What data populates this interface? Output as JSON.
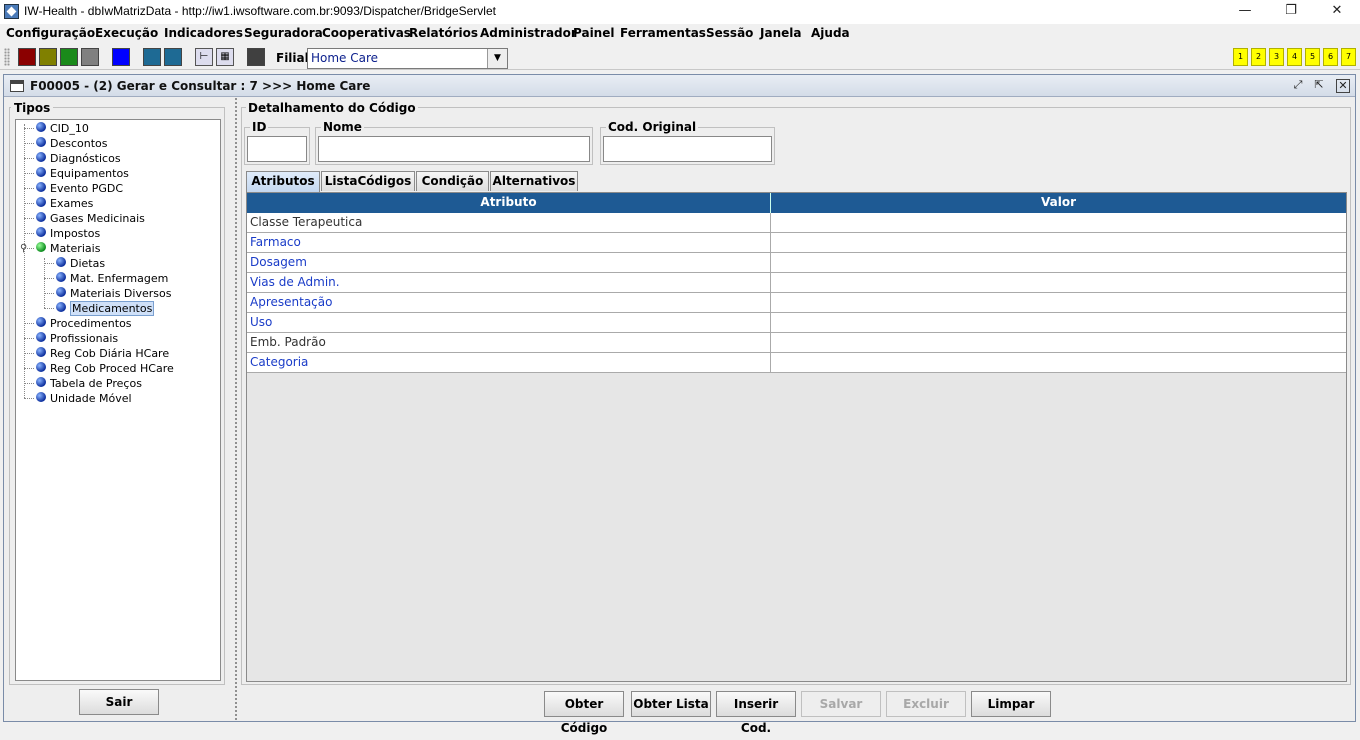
{
  "window": {
    "title": "IW-Health - dbIwMatrizData - http://iw1.iwsoftware.com.br:9093/Dispatcher/BridgeServlet",
    "minimize": "—",
    "restore": "❐",
    "close": "✕"
  },
  "menu": [
    "Configuração",
    "Execução",
    "Indicadores",
    "Seguradora",
    "Cooperativas",
    "Relatórios",
    "Administrador",
    "Painel",
    "Ferramentas",
    "Sessão",
    "Janela",
    "Ajuda"
  ],
  "toolbar": {
    "swatches": [
      "#8b0000",
      "#808000",
      "#1a8a1a",
      "#808080",
      "#0000ff",
      "#1e6a94",
      "#1e6a94",
      "#404040"
    ],
    "filial_label": "Filial:",
    "filial_value": "Home Care",
    "window_numbers": [
      "1",
      "2",
      "3",
      "4",
      "5",
      "6",
      "7"
    ]
  },
  "frame": {
    "title": "F00005 - (2) Gerar e Consultar : 7 >>> Home Care"
  },
  "tipos": {
    "label": "Tipos",
    "items": [
      "CID_10",
      "Descontos",
      "Diagnósticos",
      "Equipamentos",
      "Evento PGDC",
      "Exames",
      "Gases Medicinais",
      "Impostos",
      "Materiais",
      "Procedimentos",
      "Profissionais",
      "Reg Cob Diária HCare",
      "Reg Cob Proced HCare",
      "Tabela de Preços",
      "Unidade Móvel"
    ],
    "materiais_children": [
      "Dietas",
      "Mat. Enfermagem",
      "Materiais Diversos",
      "Medicamentos"
    ],
    "selected": "Medicamentos"
  },
  "sair": "Sair",
  "detail": {
    "label": "Detalhamento do Código",
    "id_label": "ID",
    "id_value": "",
    "nome_label": "Nome",
    "nome_value": "",
    "cod_original_label": "Cod. Original",
    "cod_original_value": ""
  },
  "tabs": [
    "Atributos",
    "ListaCódigos",
    "Condição",
    "Alternativos"
  ],
  "active_tab": "Atributos",
  "grid": {
    "headers": [
      "Atributo",
      "Valor"
    ],
    "rows": [
      {
        "atributo": "Classe Terapeutica",
        "valor": "",
        "style": "dark"
      },
      {
        "atributo": "Farmaco",
        "valor": "",
        "style": "blue"
      },
      {
        "atributo": "Dosagem",
        "valor": "",
        "style": "blue"
      },
      {
        "atributo": "Vias de Admin.",
        "valor": "",
        "style": "blue"
      },
      {
        "atributo": "Apresentação",
        "valor": "",
        "style": "blue"
      },
      {
        "atributo": "Uso",
        "valor": "",
        "style": "blue"
      },
      {
        "atributo": "Emb. Padrão",
        "valor": "",
        "style": "dark"
      },
      {
        "atributo": "Categoria",
        "valor": "",
        "style": "blue"
      }
    ]
  },
  "buttons": {
    "obter_codigo": "Obter Código",
    "obter_lista": "Obter Lista",
    "inserir_cod": "Inserir Cod.",
    "salvar": "Salvar",
    "excluir": "Excluir",
    "limpar": "Limpar"
  }
}
